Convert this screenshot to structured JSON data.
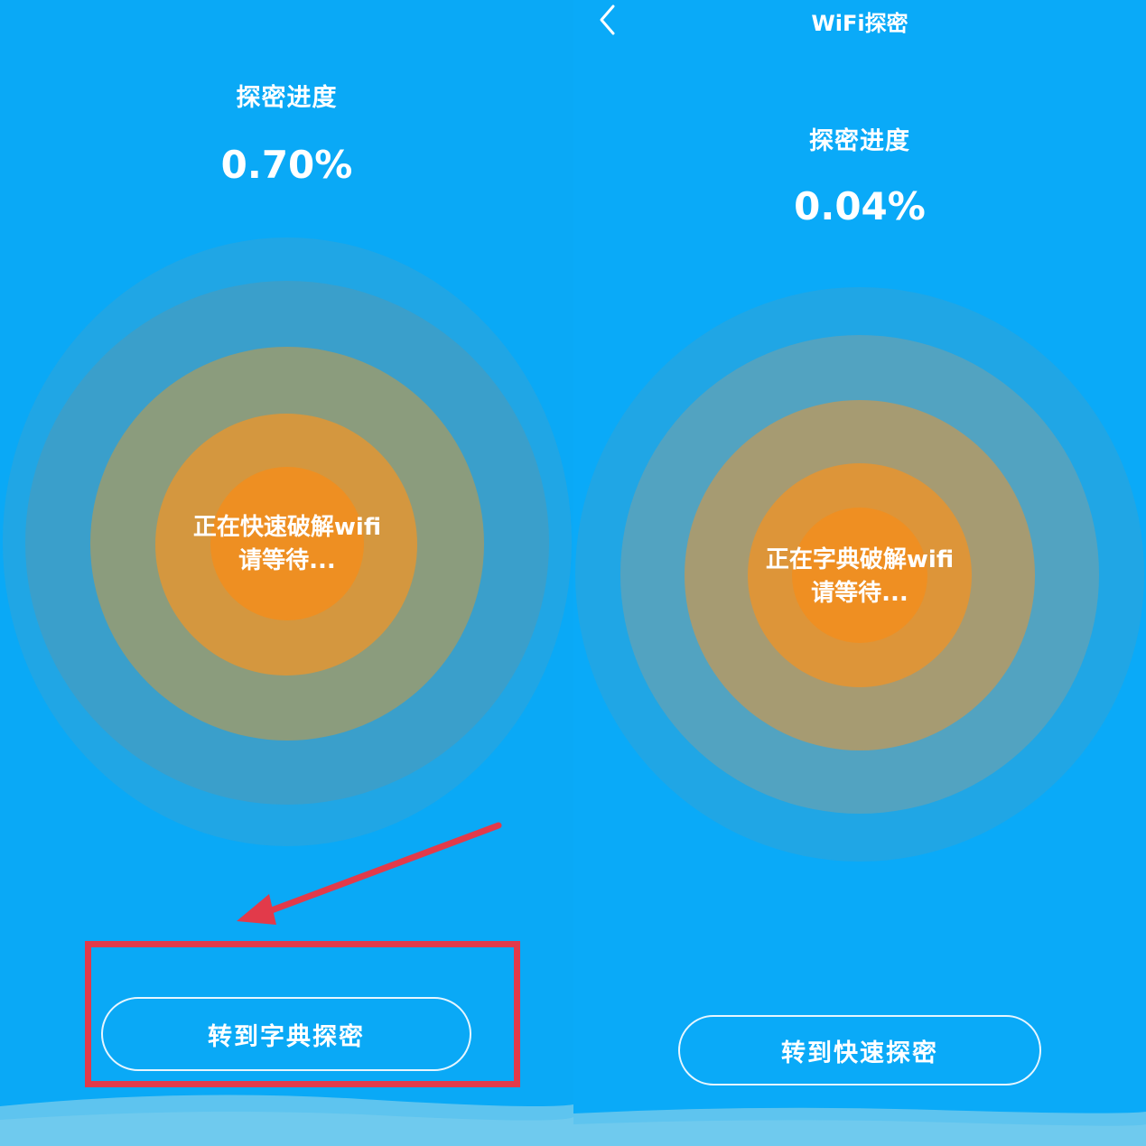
{
  "left_panel": {
    "progress_label": "探密进度",
    "progress_value": "0.70%",
    "status_line1": "正在快速破解wifi",
    "status_line2": "请等待...",
    "switch_button": "转到字典探密"
  },
  "right_panel": {
    "title": "WiFi探密",
    "progress_label": "探密进度",
    "progress_value": "0.04%",
    "status_line1": "正在字典破解wifi",
    "status_line2": "请等待...",
    "switch_button": "转到快速探密"
  },
  "icons": {
    "back": "chevron-left-icon",
    "annotation_arrow": "arrow-icon"
  },
  "colors": {
    "background": "#0aaaf7",
    "ring_outer": "#2aa2d8",
    "ring_2": "#3f9ec7",
    "ring_3": "#8c9d7a",
    "ring_4": "#d6963d",
    "ring_core": "#ee8f22",
    "highlight": "#e23a4a"
  }
}
